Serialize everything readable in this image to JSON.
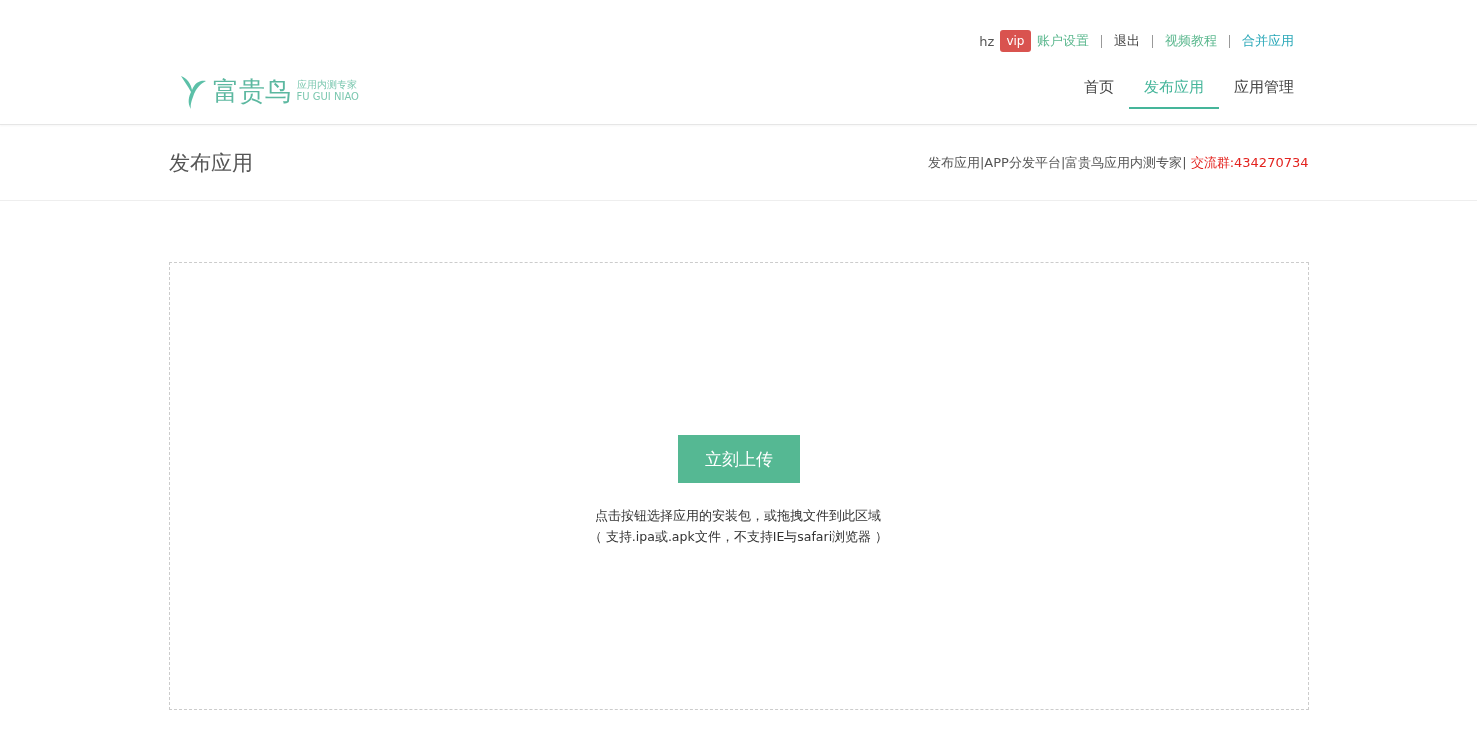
{
  "user": {
    "name": "hz",
    "badge": "vip"
  },
  "top_links": [
    {
      "label": "账户设置",
      "color": "#5cb88f"
    },
    {
      "label": "退出",
      "color": "#444444"
    },
    {
      "label": "视频教程",
      "color": "#5cb88f"
    },
    {
      "label": "合并应用",
      "color": "#2aa8b8"
    }
  ],
  "logo": {
    "name": "富贵鸟",
    "tagline": "应用内测专家",
    "latin": "FU GUI NIAO"
  },
  "nav": [
    {
      "label": "首页",
      "selected": false
    },
    {
      "label": "发布应用",
      "selected": true
    },
    {
      "label": "应用管理",
      "selected": false
    }
  ],
  "page_title": "发布应用",
  "breadcrumb": {
    "text": "发布应用|APP分发平台|富贵鸟应用内测专家|",
    "contact": "交流群:434270734"
  },
  "upload": {
    "button": "立刻上传",
    "hint": "点击按钮选择应用的安装包，或拖拽文件到此区域",
    "note": "（ 支持.ipa或.apk文件，不支持IE与safari浏览器 ）"
  }
}
